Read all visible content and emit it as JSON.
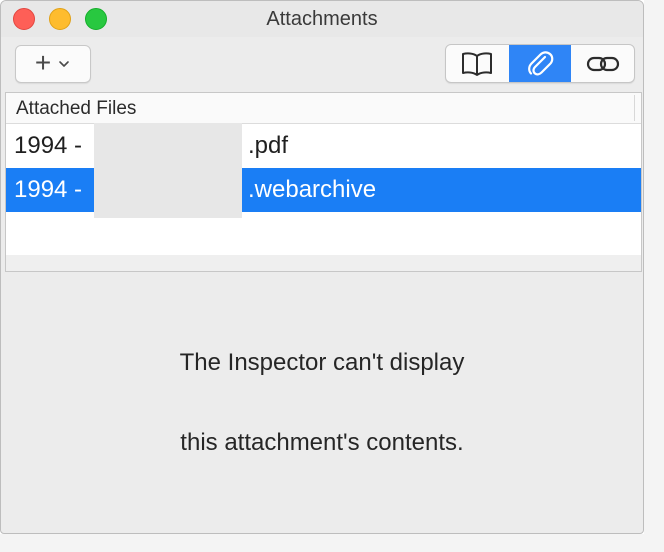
{
  "window": {
    "title": "Attachments"
  },
  "toolbar": {
    "add_label": "+",
    "segments": [
      {
        "name": "book-icon",
        "selected": false
      },
      {
        "name": "paperclip-icon",
        "selected": true
      },
      {
        "name": "link-icon",
        "selected": false
      }
    ]
  },
  "table": {
    "header": "Attached Files",
    "rows": [
      {
        "prefix": "1994 -",
        "suffix": ".pdf",
        "selected": false
      },
      {
        "prefix": "1994 -",
        "suffix": ".webarchive",
        "selected": true
      }
    ]
  },
  "message": {
    "line1": "The Inspector can't display",
    "line2": "this attachment's contents."
  },
  "colors": {
    "selection": "#1a7ef5",
    "segment_selected": "#2f85f6"
  }
}
